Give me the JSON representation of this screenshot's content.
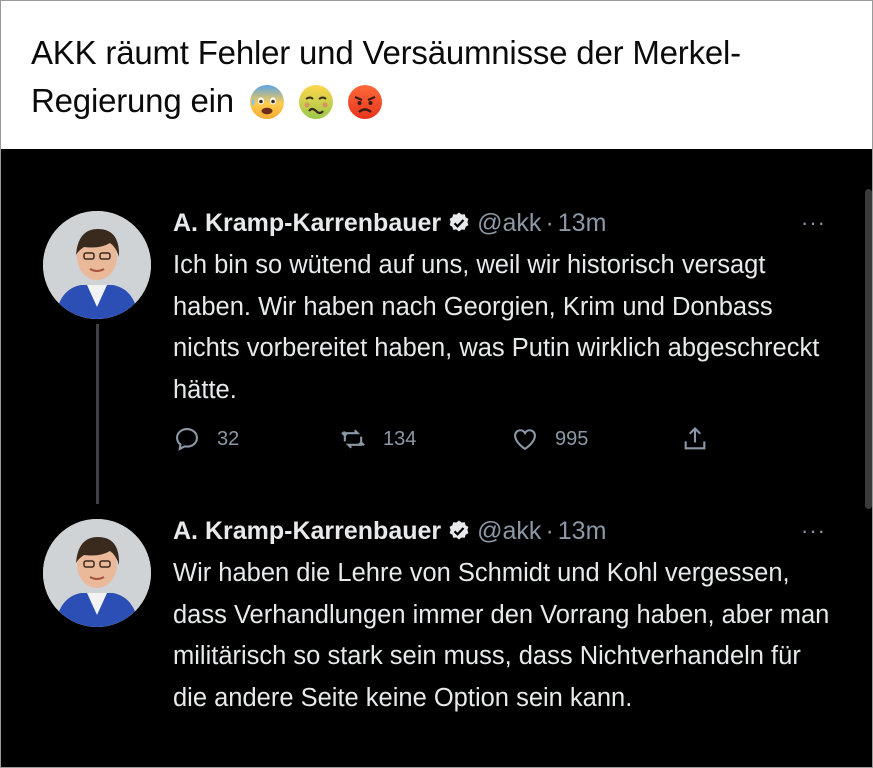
{
  "post": {
    "caption": "AKK räumt Fehler und Versäumnisse der Merkel-Regierung ein",
    "emojis": [
      "anxious-face-with-sweat-icon",
      "nauseated-face-icon",
      "pouting-face-icon"
    ]
  },
  "tweets": [
    {
      "author": "A. Kramp-Karrenbauer",
      "handle": "@akk",
      "separator": "·",
      "time": "13m",
      "more": "···",
      "text": "Ich bin so wütend auf uns, weil wir historisch versagt haben. Wir haben nach Georgien, Krim und Donbass nichts vorbereitet haben, was Putin wirklich abgeschreckt hätte.",
      "replies": "32",
      "retweets": "134",
      "likes": "995"
    },
    {
      "author": "A. Kramp-Karrenbauer",
      "handle": "@akk",
      "separator": "·",
      "time": "13m",
      "more": "···",
      "text": "Wir haben die Lehre von Schmidt und Kohl vergessen, dass Verhandlungen immer den Vorrang haben, aber man militärisch so stark sein muss, dass Nichtverhandeln für die andere Seite keine Option sein kann."
    }
  ],
  "colors": {
    "background": "#000000",
    "text": "#e7e9ea",
    "muted": "#8b98a5",
    "verified": "#e7e9ea"
  }
}
